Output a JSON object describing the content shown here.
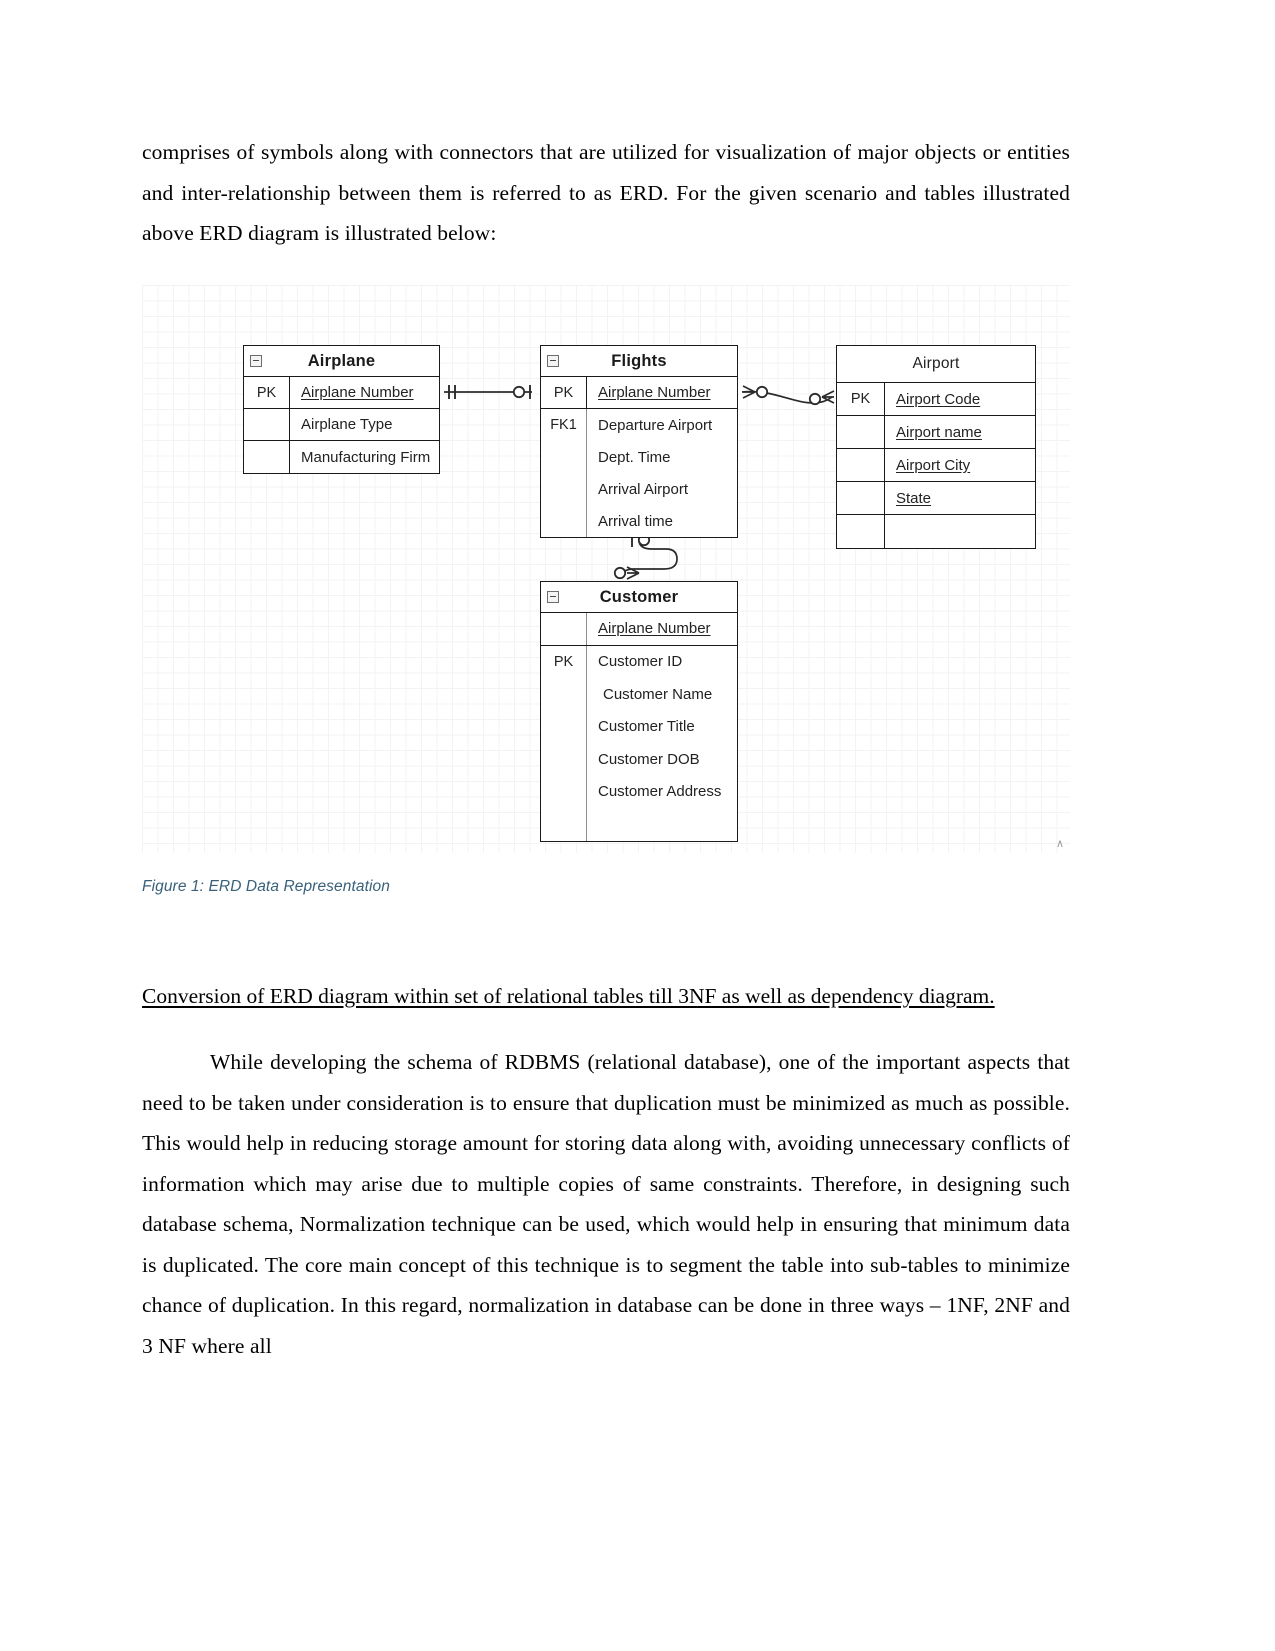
{
  "document": {
    "paragraph_top": "comprises of symbols along with connectors that are utilized for visualization of major objects or entities and inter-relationship between them is referred to as ERD. For the given scenario and tables illustrated above ERD diagram is illustrated below:",
    "figure_caption": "Figure 1: ERD Data Representation",
    "section_heading": "Conversion of ERD diagram within set of relational tables till 3NF as well as dependency diagram.",
    "paragraph_body": "While developing the schema of RDBMS (relational database), one of the important aspects that need to be taken under consideration is to ensure that duplication must be minimized as much as possible. This would help in reducing storage amount for storing data along with, avoiding unnecessary conflicts of information which may arise due to multiple copies of same constraints. Therefore, in designing such database schema, Normalization technique can be used, which would help in ensuring that minimum data is duplicated. The core main concept of this technique is to segment the table into sub-tables to minimize chance of duplication. In this regard, normalization in database can be done in three ways – 1NF, 2NF and 3 NF where all",
    "corner_mark": "∧"
  },
  "erd": {
    "entities": {
      "airplane": {
        "title": "Airplane",
        "rows": [
          {
            "key": "PK",
            "attr": "Airplane Number",
            "underline": true
          },
          {
            "key": "",
            "attr": "Airplane Type",
            "underline": false
          },
          {
            "key": "",
            "attr": "Manufacturing Firm",
            "underline": false
          }
        ]
      },
      "flights": {
        "title": "Flights",
        "rows": [
          {
            "key": "PK",
            "attr": "Airplane Number",
            "underline": true
          },
          {
            "key": "FK1",
            "attr": "Departure Airport",
            "underline": false
          },
          {
            "key": "",
            "attr": "Dept. Time",
            "underline": false
          },
          {
            "key": "",
            "attr": "Arrival Airport",
            "underline": false
          },
          {
            "key": "",
            "attr": "Arrival time",
            "underline": false
          }
        ]
      },
      "airport": {
        "title": "Airport",
        "rows": [
          {
            "key": "PK",
            "attr": "Airport Code",
            "underline": true
          },
          {
            "key": "",
            "attr": "Airport name",
            "underline": true
          },
          {
            "key": "",
            "attr": "Airport City",
            "underline": true
          },
          {
            "key": "",
            "attr": "State",
            "underline": true
          }
        ]
      },
      "customer": {
        "title": "Customer",
        "rows": [
          {
            "key": "",
            "attr": "Airplane Number",
            "underline": true
          },
          {
            "key": "PK",
            "attr": "Customer ID",
            "underline": false
          },
          {
            "key": "",
            "attr": "Customer Name",
            "underline": false
          },
          {
            "key": "",
            "attr": "Customer Title",
            "underline": false
          },
          {
            "key": "",
            "attr": "Customer DOB",
            "underline": false
          },
          {
            "key": "",
            "attr": "Customer Address",
            "underline": false
          }
        ]
      }
    },
    "relationships": [
      {
        "from": "Airplane",
        "to": "Flights",
        "from_cardinality": "one-and-only-one",
        "to_cardinality": "zero-or-one"
      },
      {
        "from": "Flights",
        "to": "Airport",
        "from_cardinality": "zero-or-many",
        "to_cardinality": "zero-or-many"
      },
      {
        "from": "Flights",
        "to": "Customer",
        "from_cardinality": "zero-or-one",
        "to_cardinality": "zero-or-many"
      }
    ]
  },
  "colors": {
    "text": "#000000",
    "caption": "#39607a",
    "entity_border": "#1a1a1a",
    "grid_minor": "#f2f3f5",
    "grid_major": "#e8eaec"
  }
}
